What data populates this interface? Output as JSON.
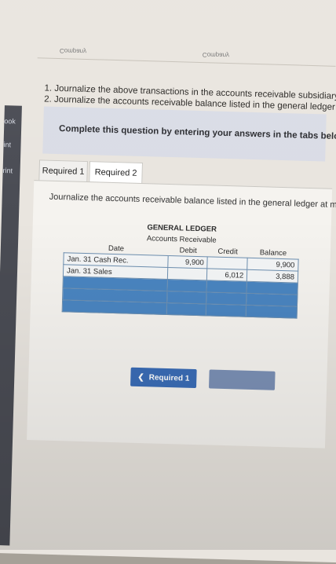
{
  "header": {
    "company_mirrored_left": "Company",
    "company_mirrored_right": "Company"
  },
  "sidebar": {
    "tabs": [
      "ook",
      "int",
      "rint"
    ]
  },
  "instructions": {
    "line1": "1. Journalize the above transactions in the accounts receivable subsidiary ledger.",
    "line2": "2. Journalize the accounts receivable balance listed in the general ledger at month's end."
  },
  "panel": {
    "prompt": "Complete this question by entering your answers in the tabs below."
  },
  "tabs": [
    "Required 1",
    "Required 2"
  ],
  "content": {
    "text": "Journalize the accounts receivable balance listed in the general ledger at month's end."
  },
  "ledger": {
    "title": "GENERAL LEDGER",
    "subtitle": "Accounts Receivable",
    "columns": [
      "Date",
      "Debit",
      "Credit",
      "Balance"
    ],
    "rows": [
      {
        "date": "Jan. 31 Cash Rec.",
        "debit": "9,900",
        "credit": "",
        "balance": "9,900"
      },
      {
        "date": "Jan. 31 Sales",
        "debit": "",
        "credit": "6,012",
        "balance": "3,888"
      }
    ]
  },
  "nav": {
    "prev_label": "Required 1"
  }
}
